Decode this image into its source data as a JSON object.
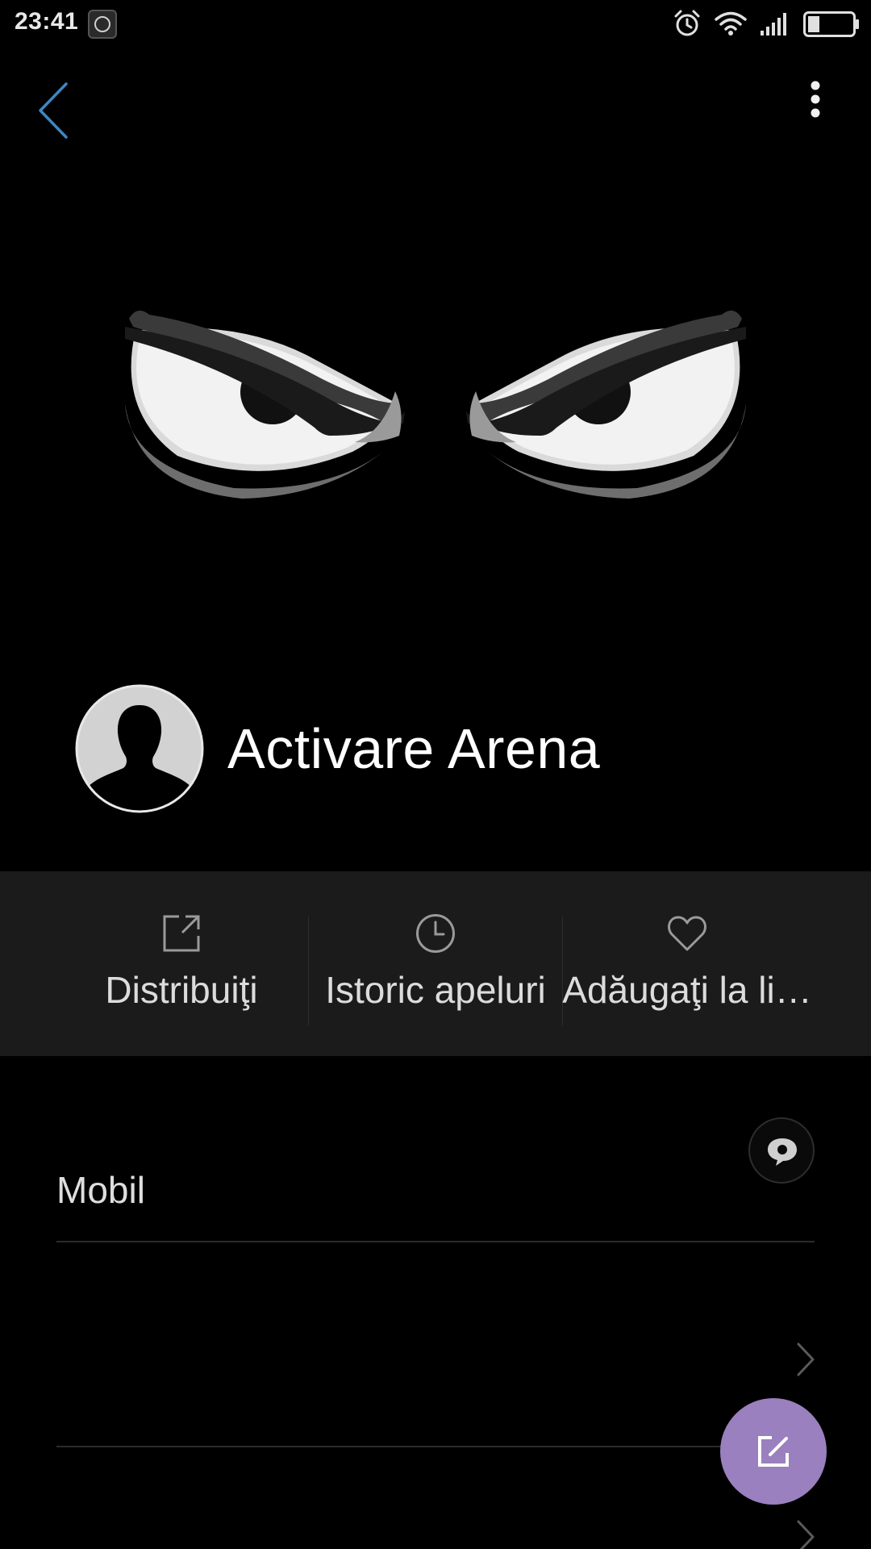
{
  "status_bar": {
    "time": "23:41",
    "icons": [
      "app-notification-icon",
      "alarm-icon",
      "wifi-icon",
      "signal-icon",
      "battery-icon"
    ]
  },
  "header": {
    "back_icon": "chevron-left-icon",
    "menu_icon": "more-vertical-icon",
    "accent_color": "#3f86c2"
  },
  "contact": {
    "name": "Activare Arena",
    "avatar": "default-person-avatar"
  },
  "actions": [
    {
      "label": "Distribuiţi",
      "icon": "share-icon"
    },
    {
      "label": "Istoric apeluri",
      "icon": "clock-icon"
    },
    {
      "label": "Adăugaţi la li…",
      "icon": "heart-icon"
    }
  ],
  "details": {
    "phone_type": "Mobil",
    "message_icon": "message-bubble-icon"
  },
  "fab": {
    "icon": "edit-icon",
    "color": "#9a80be"
  }
}
